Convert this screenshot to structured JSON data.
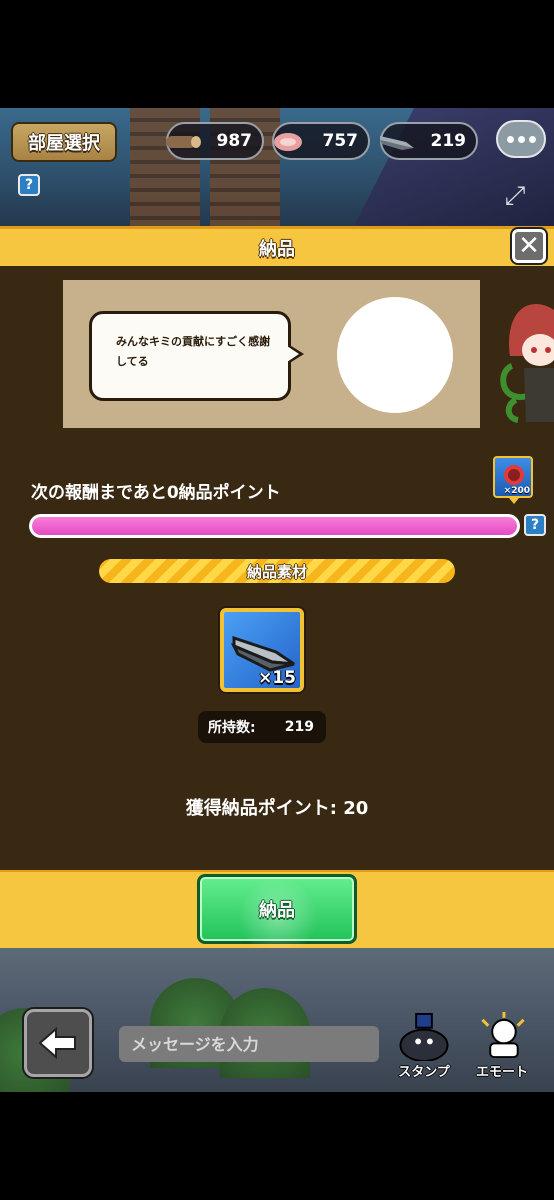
{
  "top_bar": {
    "room_select_label": "部屋選択",
    "help_label": "?",
    "resources": [
      {
        "icon": "log-icon",
        "value": "987"
      },
      {
        "icon": "meat-icon",
        "value": "757"
      },
      {
        "icon": "blade-icon",
        "value": "219"
      }
    ]
  },
  "modal": {
    "title": "納品",
    "close_label": "✕",
    "speech_text": "みんなキミの貢献にすごく感謝してる",
    "reward_count": "×200",
    "next_reward_text": "次の報酬まであと0納品ポイント",
    "progress_fraction": 1.0,
    "progress_help_label": "?",
    "material_header": "納品素材",
    "material_qty": "×15",
    "owned_label": "所持数:",
    "owned_value": "219",
    "points_text": "獲得納品ポイント: 20",
    "deliver_label": "納品"
  },
  "bottom_bar": {
    "message_placeholder": "メッセージを入力",
    "stamp_label": "スタンプ",
    "emote_label": "エモート"
  },
  "colors": {
    "panel_bg": "#3a2912",
    "header_yellow": "#f7c640",
    "progress_pink": "#e54bc4",
    "deliver_green": "#22c25a"
  }
}
